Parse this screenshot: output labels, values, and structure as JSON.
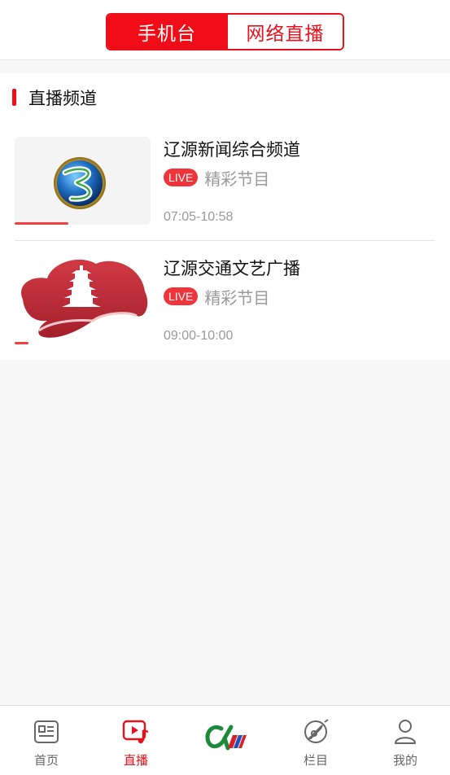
{
  "header": {
    "tabs": [
      {
        "label": "手机台",
        "active": true
      },
      {
        "label": "网络直播",
        "active": false
      }
    ]
  },
  "section": {
    "title": "直播频道"
  },
  "channels": [
    {
      "name": "辽源新闻综合频道",
      "live_badge": "LIVE",
      "program": "精彩节目",
      "time": "07:05-10:58",
      "logo": "globe-swirl-logo",
      "progress": 0.4
    },
    {
      "name": "辽源交通文艺广播",
      "live_badge": "LIVE",
      "program": "精彩节目",
      "time": "09:00-10:00",
      "logo": "red-pagoda-cloud-logo",
      "progress": 0.1
    }
  ],
  "nav": {
    "items": [
      {
        "label": "首页",
        "icon": "news-icon",
        "active": false
      },
      {
        "label": "直播",
        "icon": "live-play-icon",
        "active": true
      },
      {
        "label": "",
        "icon": "brand-logo-icon",
        "active": false
      },
      {
        "label": "栏目",
        "icon": "compass-icon",
        "active": false
      },
      {
        "label": "我的",
        "icon": "user-icon",
        "active": false
      }
    ]
  },
  "colors": {
    "accent": "#f00d17",
    "live_badge": "#f0343b",
    "muted_text": "#999999"
  }
}
